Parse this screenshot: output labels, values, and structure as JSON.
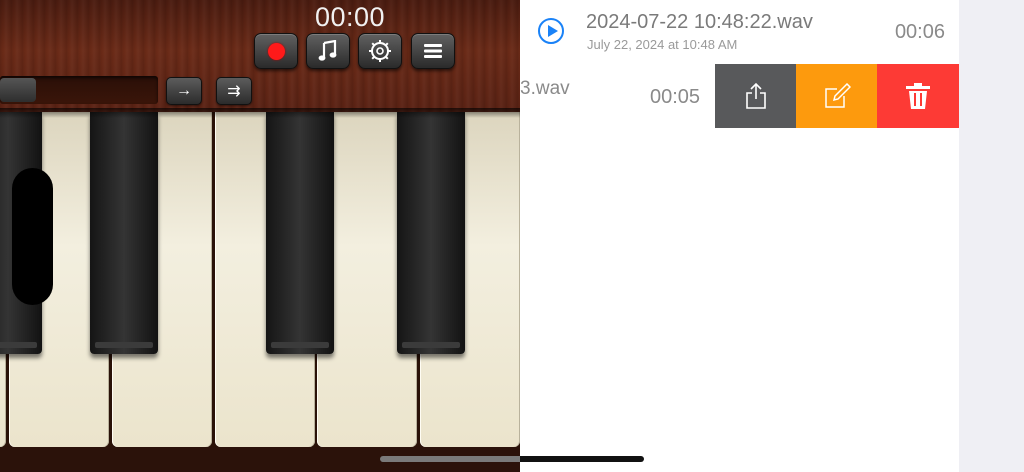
{
  "piano": {
    "timer": "00:00",
    "toolbar": {
      "record_label": "Record",
      "note_icon": "music-note-icon",
      "settings_icon": "settings-icon",
      "menu_icon": "menu-icon"
    },
    "shift_right": "→",
    "shift_right_fast": "⇉"
  },
  "recordings": [
    {
      "title": "2024-07-22 10:48:22.wav",
      "date": "July 22, 2024 at 10:48 AM",
      "duration": "00:06"
    },
    {
      "title": "3.wav",
      "duration": "00:05",
      "actions": {
        "share_icon": "share-icon",
        "edit_icon": "edit-icon",
        "delete_icon": "trash-icon"
      }
    }
  ],
  "colors": {
    "play_blue": "#1a82f7",
    "share_gray": "#58595b",
    "edit_orange": "#fd9a0d",
    "delete_red": "#fd3a35",
    "record_red": "#ff1a1a"
  }
}
